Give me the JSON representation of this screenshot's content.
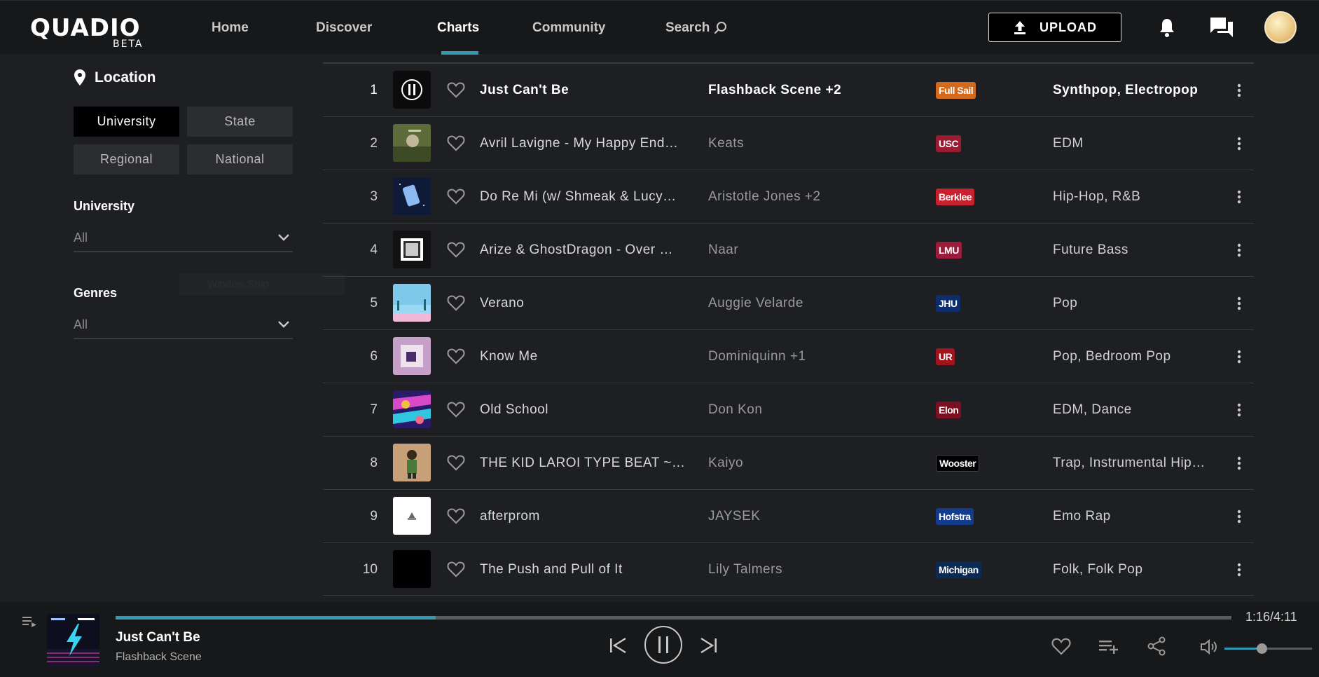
{
  "header": {
    "logo": "QUADIO",
    "logo_sub": "BETA",
    "nav": [
      {
        "label": "Home",
        "active": false
      },
      {
        "label": "Discover",
        "active": false
      },
      {
        "label": "Charts",
        "active": true
      },
      {
        "label": "Community",
        "active": false
      },
      {
        "label": "Search",
        "active": false
      }
    ],
    "upload_label": "UPLOAD",
    "icons": [
      "upload-icon",
      "bell-icon",
      "chat-icon",
      "search-icon"
    ]
  },
  "sidebar": {
    "location_title": "Location",
    "location_options": [
      {
        "label": "University",
        "selected": true
      },
      {
        "label": "State",
        "selected": false
      },
      {
        "label": "Regional",
        "selected": false
      },
      {
        "label": "National",
        "selected": false
      }
    ],
    "university_label": "University",
    "university_value": "All",
    "genres_label": "Genres",
    "genres_value": "All",
    "ghost_text": "Window Snip"
  },
  "chart": {
    "rows": [
      {
        "rank": "1",
        "title": "Just Can't Be",
        "artist": "Flashback Scene +2",
        "school": "Full Sail",
        "school_color": "#d4691c",
        "genre": "Synthpop, Electropop"
      },
      {
        "rank": "2",
        "title": "Avril Lavigne - My Happy End…",
        "artist": "Keats",
        "school": "USC",
        "school_color": "#9b1c31",
        "genre": "EDM"
      },
      {
        "rank": "3",
        "title": "Do Re Mi (w/ Shmeak & Lucy…",
        "artist": "Aristotle Jones +2",
        "school": "Berklee",
        "school_color": "#c8202e",
        "genre": "Hip-Hop, R&B"
      },
      {
        "rank": "4",
        "title": "Arize & GhostDragon - Over …",
        "artist": "Naar",
        "school": "LMU",
        "school_color": "#9c1c3c",
        "genre": "Future Bass"
      },
      {
        "rank": "5",
        "title": "Verano",
        "artist": "Auggie Velarde",
        "school": "JHU",
        "school_color": "#0d2d6c",
        "genre": "Pop"
      },
      {
        "rank": "6",
        "title": "Know Me",
        "artist": "Dominiquinn +1",
        "school": "UR",
        "school_color": "#a0141e",
        "genre": "Pop, Bedroom Pop"
      },
      {
        "rank": "7",
        "title": "Old School",
        "artist": "Don Kon",
        "school": "Elon",
        "school_color": "#7a1020",
        "genre": "EDM, Dance"
      },
      {
        "rank": "8",
        "title": "THE KID LAROI TYPE BEAT ~…",
        "artist": "Kaiyo",
        "school": "Wooster",
        "school_color": "#000000",
        "genre": "Trap, Instrumental Hip…"
      },
      {
        "rank": "9",
        "title": "afterprom",
        "artist": "JAYSEK",
        "school": "Hofstra",
        "school_color": "#143c8c",
        "genre": "Emo Rap"
      },
      {
        "rank": "10",
        "title": "The Push and Pull of It",
        "artist": "Lily Talmers",
        "school": "Michigan",
        "school_color": "#0b2a52",
        "genre": "Folk, Folk Pop"
      }
    ]
  },
  "player": {
    "title": "Just Can't Be",
    "artist": "Flashback Scene",
    "time": "1:16/4:11",
    "progress": 0.2868,
    "volume": 0.42,
    "accent_color": "#2e9bb0"
  }
}
